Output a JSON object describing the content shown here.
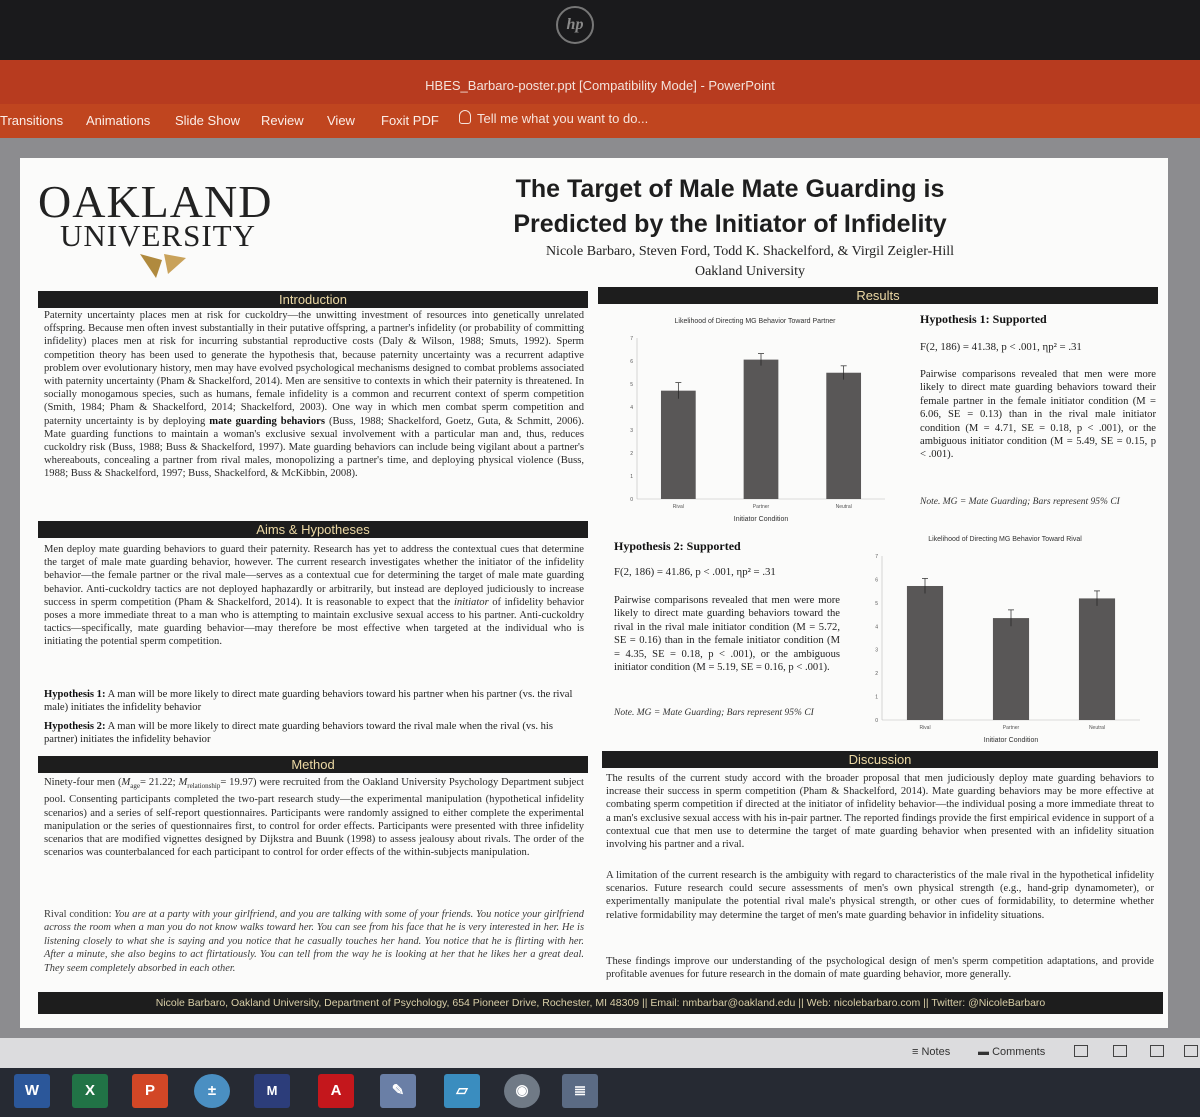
{
  "window": {
    "title": "HBES_Barbaro-poster.ppt [Compatibility Mode] - PowerPoint",
    "hp_logo": "hp"
  },
  "ribbon": {
    "tabs": [
      "Transitions",
      "Animations",
      "Slide Show",
      "Review",
      "View",
      "Foxit PDF"
    ],
    "tell_me": "Tell me what you want to do..."
  },
  "poster": {
    "logo_line1": "OAKLAND",
    "logo_line2": "UNIVERSITY",
    "title_line1": "The Target of Male Mate Guarding is",
    "title_line2": "Predicted by the Initiator of Infidelity",
    "authors": "Nicole Barbaro, Steven Ford, Todd K. Shackelford, & Virgil Zeigler-Hill",
    "affiliation": "Oakland University",
    "introduction": {
      "header": "Introduction",
      "text_a": "Paternity uncertainty places men at risk for cuckoldry—the unwitting investment of resources into genetically unrelated offspring. Because men often invest substantially in their putative offspring, a partner's infidelity (or probability of committing infidelity) places men at risk for incurring substantial reproductive costs (Daly & Wilson, 1988; Smuts, 1992). Sperm competition theory has been used to generate the hypothesis that, because paternity uncertainty was a recurrent adaptive problem over evolutionary history, men may have evolved psychological mechanisms designed to combat problems associated with paternity uncertainty (Pham & Shackelford, 2014). Men are sensitive to contexts in which their paternity is threatened. In socially monogamous species, such as humans, female infidelity is a common and recurrent context of sperm competition (Smith, 1984; Pham & Shackelford, 2014; Shackelford, 2003). One way in which men combat sperm competition and paternity uncertainty is by deploying ",
      "text_bold": "mate guarding behaviors",
      "text_b": " (Buss, 1988; Shackelford, Goetz, Guta, & Schmitt, 2006). Mate guarding functions to maintain a woman's exclusive sexual involvement with a particular man and, thus, reduces cuckoldry risk (Buss, 1988; Buss & Shackelford, 1997). Mate guarding behaviors can include being vigilant about a partner's whereabouts, concealing a partner from rival males, monopolizing a partner's time, and deploying physical violence (Buss, 1988; Buss & Shackelford, 1997; Buss, Shackelford, & McKibbin, 2008)."
    },
    "aims": {
      "header": "Aims & Hypotheses",
      "text_a": "Men deploy mate guarding behaviors to guard their paternity. Research has yet to address the contextual cues that determine the target of male mate guarding behavior, however. The current research investigates whether the initiator of the infidelity behavior—the female partner or the rival male—serves as a contextual cue for determining the target of male mate guarding behavior. Anti-cuckoldry tactics are not deployed haphazardly or arbitrarily, but instead are deployed judiciously to increase success in sperm competition (Pham & Shackelford, 2014). It is reasonable to expect that the ",
      "text_italic": "initiator",
      "text_b": " of infidelity behavior poses a more immediate threat to a man who is attempting to maintain exclusive sexual access to his partner. Anti-cuckoldry tactics—specifically, mate guarding behavior—may therefore be most effective when targeted at the individual who is initiating the potential sperm competition.",
      "h1_label": "Hypothesis 1:",
      "h1_text": " A man will be more likely to direct mate guarding behaviors toward his partner when his partner (vs. the rival male) initiates the infidelity behavior",
      "h2_label": "Hypothesis 2:",
      "h2_text": " A man will be more likely to direct mate guarding behaviors toward the rival male when the rival (vs. his partner) initiates the infidelity behavior"
    },
    "method": {
      "header": "Method",
      "text_a": "Ninety-four men (",
      "m_age": "M",
      "m_age_sub": "age",
      "m_age_val": "= 21.22; ",
      "m_rel": "M",
      "m_rel_sub": "relationship",
      "m_rel_val": "= 19.97",
      "text_b": ") were recruited from the Oakland University Psychology Department subject pool. Consenting participants completed the two-part research study—the experimental manipulation (hypothetical infidelity scenarios) and a series of self-report questionnaires. Participants were randomly assigned to either complete the experimental manipulation or the series of questionnaires first, to control for order effects. Participants were presented with three infidelity scenarios that are modified vignettes designed by Dijkstra and Buunk (1998) to assess jealousy about rivals. The order of the scenarios was counterbalanced for each participant to control for order effects of the within-subjects manipulation.",
      "scenario_label": "Rival condition: ",
      "scenario_text": "You are at a party with your girlfriend, and you are talking with some of your friends. You notice your girlfriend across the room when a man you do not know walks toward her. You can see from his face that he is very interested in her. He is listening closely to what she is saying and you notice that he casually touches her hand. You notice that he is flirting with her. After a minute, she also begins to act flirtatiously. You can tell from the way he is looking at her that he likes her a great deal. They seem completely absorbed in each other."
    },
    "results": {
      "header": "Results",
      "h1_title": "Hypothesis 1: Supported",
      "h1_stat": "F(2, 186) = 41.38, p < .001, ηp² = .31",
      "h1_text": "Pairwise comparisons revealed that men were more likely to direct mate guarding behaviors toward their female partner in the female initiator condition (M = 6.06, SE = 0.13) than in the rival male initiator condition (M = 4.71, SE = 0.18, p < .001), or the ambiguous initiator condition (M = 5.49, SE = 0.15, p < .001).",
      "h1_note": "Note. MG = Mate Guarding; Bars represent 95% CI",
      "h2_title": "Hypothesis 2: Supported",
      "h2_stat": "F(2, 186) = 41.86, p < .001, ηp² = .31",
      "h2_text": "Pairwise comparisons revealed that men were more likely to direct mate guarding behaviors toward the rival in the rival male initiator condition (M = 5.72, SE = 0.16) than in the female initiator condition (M = 4.35, SE = 0.18, p < .001), or the ambiguous initiator condition (M = 5.19, SE = 0.16, p < .001).",
      "h2_note": "Note. MG = Mate Guarding; Bars represent 95% CI"
    },
    "discussion": {
      "header": "Discussion",
      "p1": "The results of the current study accord with the broader proposal that men judiciously deploy mate guarding behaviors to increase their success in sperm competition (Pham & Shackelford, 2014). Mate guarding behaviors may be more effective at combating sperm competition if directed at the initiator of infidelity behavior—the individual posing a more immediate threat to a man's exclusive sexual access with his in-pair partner. The reported findings provide the first empirical evidence in support of a contextual cue that men use to determine the target of mate guarding behavior when presented with an infidelity situation involving his partner and a rival.",
      "p2": "A limitation of the current research is the ambiguity with regard to characteristics of the male rival in the hypothetical infidelity scenarios. Future research could secure assessments of men's own physical strength (e.g., hand-grip dynamometer), or experimentally manipulate the potential rival male's physical strength, or other cues of formidability, to determine whether relative formidability may determine the target of men's mate guarding behavior in infidelity situations.",
      "p3": "These findings improve our understanding of the psychological design of men's sperm competition adaptations, and provide profitable avenues for future research in the domain of mate guarding behavior, more generally."
    },
    "footer": "Nicole Barbaro, Oakland University, Department of Psychology, 654 Pioneer Drive, Rochester, MI 48309  ||  Email: nmbarbar@oakland.edu  ||  Web: nicolebarbaro.com  ||  Twitter: @NicoleBarbaro"
  },
  "chart_data": [
    {
      "type": "bar",
      "title": "Likelihood of Directing MG Behavior Toward Partner",
      "xlabel": "Initiator Condition",
      "ylabel": "",
      "categories": [
        "Rival",
        "Partner",
        "Neutral"
      ],
      "values": [
        4.71,
        6.06,
        5.49
      ],
      "error": [
        0.35,
        0.26,
        0.3
      ],
      "ylim": [
        0,
        7
      ],
      "bar_color": "#595757"
    },
    {
      "type": "bar",
      "title": "Likelihood of Directing MG Behavior Toward Rival",
      "xlabel": "Initiator Condition",
      "ylabel": "",
      "categories": [
        "Rival",
        "Partner",
        "Neutral"
      ],
      "values": [
        5.72,
        4.35,
        5.19
      ],
      "error": [
        0.32,
        0.35,
        0.32
      ],
      "ylim": [
        0,
        7
      ],
      "bar_color": "#595757"
    }
  ],
  "statusbar": {
    "notes": "Notes",
    "comments": "Comments"
  },
  "taskbar": {
    "apps": [
      "word-icon",
      "excel-icon",
      "powerpoint-icon",
      "calculator-icon",
      "mplus-icon",
      "acrobat-icon",
      "paint-icon",
      "notepad-icon",
      "media-icon",
      "document-icon"
    ]
  },
  "colors": {
    "accent": "#c0451f",
    "header_bg": "#1d1d1d",
    "header_text": "#ecd9a5"
  }
}
